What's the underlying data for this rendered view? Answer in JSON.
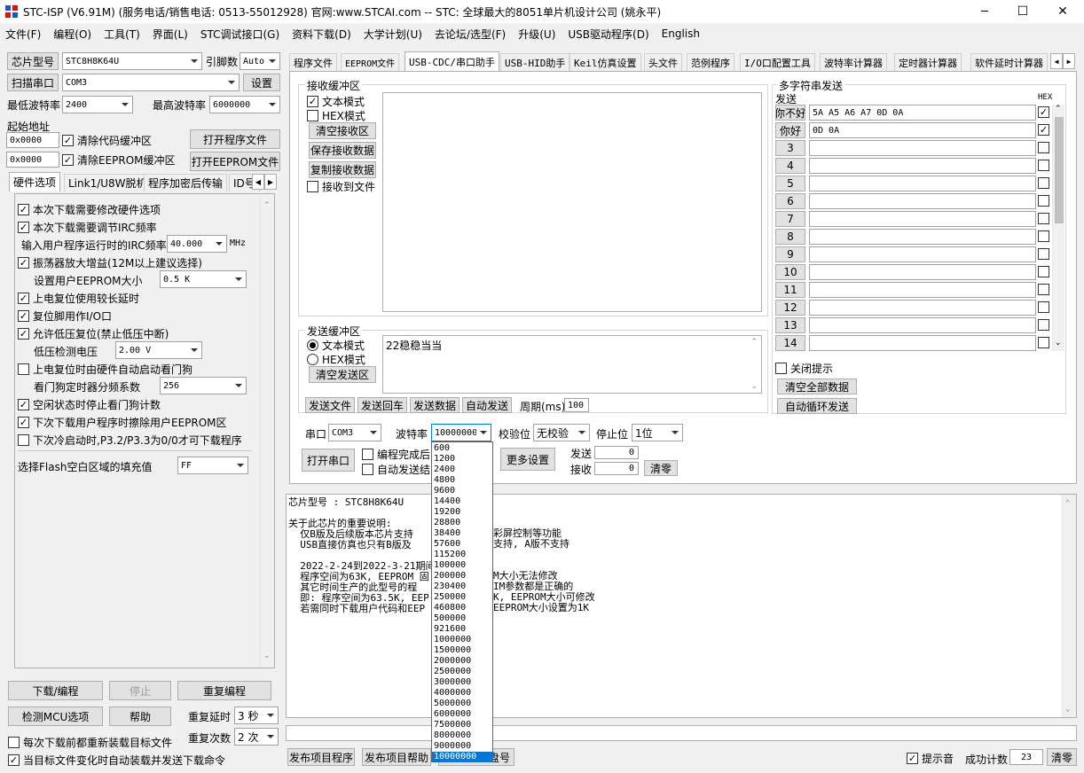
{
  "window": {
    "title": "STC-ISP (V6.91M) (服务电话/销售电话: 0513-55012928) 官网:www.STCAI.com  -- STC: 全球最大的8051单片机设计公司 (姚永平)",
    "controls": [
      "─",
      "☐",
      "✕"
    ]
  },
  "menu": [
    "文件(F)",
    "编程(O)",
    "工具(T)",
    "界面(L)",
    "STC调试接口(G)",
    "资料下载(D)",
    "大学计划(U)",
    "去论坛/选型(F)",
    "升级(U)",
    "USB驱动程序(D)",
    "English"
  ],
  "left": {
    "chip_btn": "芯片型号",
    "chip_value": "STC8H8K64U",
    "pins_label": "引脚数",
    "pins_value": "Auto",
    "scan_btn": "扫描串口",
    "port_value": "COM3",
    "settings_btn": "设置",
    "min_baud_label": "最低波特率",
    "min_baud_value": "2400",
    "max_baud_label": "最高波特率",
    "max_baud_value": "6000000",
    "start_addr_label": "起始地址",
    "addr1": "0x0000",
    "clear_code": "清除代码缓冲区",
    "open_prog": "打开程序文件",
    "addr2": "0x0000",
    "clear_eeprom": "清除EEPROM缓冲区",
    "open_eeprom": "打开EEPROM文件",
    "tabs": [
      "硬件选项",
      "Link1/U8W脱机",
      "程序加密后传输",
      "ID号"
    ],
    "hw": {
      "opt1": "本次下载需要修改硬件选项",
      "opt2": "本次下载需要调节IRC频率",
      "irc_label": "输入用户程序运行时的IRC频率",
      "irc_value": "40.000",
      "irc_unit": "MHz",
      "opt3": "振荡器放大增益(12M以上建议选择)",
      "eeprom_label": "设置用户EEPROM大小",
      "eeprom_value": "0.5 K",
      "opt4": "上电复位使用较长延时",
      "opt5": "复位脚用作I/O口",
      "opt6": "允许低压复位(禁止低压中断)",
      "lv_label": "低压检测电压",
      "lv_value": "2.00 V",
      "opt7": "上电复位时由硬件自动启动看门狗",
      "wdt_label": "看门狗定时器分频系数",
      "wdt_value": "256",
      "opt8": "空闲状态时停止看门狗计数",
      "opt9": "下次下载用户程序时擦除用户EEPROM区",
      "opt10": "下次冷启动时,P3.2/P3.3为0/0才可下载程序",
      "fill_label": "选择Flash空白区域的填充值",
      "fill_value": "FF"
    },
    "download_btn": "下载/编程",
    "stop_btn": "停止",
    "reprog_btn": "重复编程",
    "detect_btn": "检测MCU选项",
    "help_btn": "帮助",
    "delay_label": "重复延时",
    "delay_value": "3 秒",
    "times_label": "重复次数",
    "times_value": "2 次",
    "reload_each": "每次下载前都重新装载目标文件",
    "auto_reload": "当目标文件变化时自动装载并发送下载命令"
  },
  "tabs": [
    "程序文件",
    "EEPROM文件",
    "USB-CDC/串口助手",
    "USB-HID助手",
    "Keil仿真设置",
    "头文件",
    "范例程序",
    "I/O口配置工具",
    "波特率计算器",
    "定时器计算器",
    "软件延时计算器"
  ],
  "recv": {
    "title": "接收缓冲区",
    "text_mode": "文本模式",
    "hex_mode": "HEX模式",
    "clear": "清空接收区",
    "save": "保存接收数据",
    "copy": "复制接收数据",
    "to_file": "接收到文件"
  },
  "send": {
    "title": "发送缓冲区",
    "text_mode": "文本模式",
    "hex_mode": "HEX模式",
    "clear": "清空发送区",
    "content": "22稳稳当当",
    "send_file": "发送文件",
    "send_cr": "发送回车",
    "send_data": "发送数据",
    "auto_send": "自动发送",
    "period_label": "周期(ms)",
    "period_value": "100"
  },
  "multi": {
    "title": "多字符串发送",
    "send_label": "发送",
    "hex_label": "HEX",
    "rows": [
      {
        "btn": "你不好",
        "value": "5A A5 A6 A7 0D 0A",
        "hex": true
      },
      {
        "btn": "你好",
        "value": "0D 0A",
        "hex": true
      },
      {
        "btn": "3",
        "value": "",
        "hex": false
      },
      {
        "btn": "4",
        "value": "",
        "hex": false
      },
      {
        "btn": "5",
        "value": "",
        "hex": false
      },
      {
        "btn": "6",
        "value": "",
        "hex": false
      },
      {
        "btn": "7",
        "value": "",
        "hex": false
      },
      {
        "btn": "8",
        "value": "",
        "hex": false
      },
      {
        "btn": "9",
        "value": "",
        "hex": false
      },
      {
        "btn": "10",
        "value": "",
        "hex": false
      },
      {
        "btn": "11",
        "value": "",
        "hex": false
      },
      {
        "btn": "12",
        "value": "",
        "hex": false
      },
      {
        "btn": "13",
        "value": "",
        "hex": false
      },
      {
        "btn": "14",
        "value": "",
        "hex": false
      }
    ],
    "close_tip": "关闭提示",
    "clear_all": "清空全部数据",
    "auto_loop": "自动循环发送"
  },
  "serial": {
    "port_label": "串口",
    "port_value": "COM3",
    "baud_label": "波特率",
    "baud_value": "10000000",
    "parity_label": "校验位",
    "parity_value": "无校验",
    "stop_label": "停止位",
    "stop_value": "1位",
    "open_btn": "打开串口",
    "opt1": "编程完成后自",
    "opt2": "自动发送结",
    "more_btn": "更多设置",
    "sent_label": "发送",
    "sent_value": "0",
    "recv_label": "接收",
    "recv_value": "0",
    "clear_btn": "清零"
  },
  "baud_options": [
    "600",
    "1200",
    "2400",
    "4800",
    "9600",
    "14400",
    "19200",
    "28800",
    "38400",
    "57600",
    "115200",
    "100000",
    "200000",
    "230400",
    "250000",
    "460800",
    "500000",
    "921600",
    "1000000",
    "1500000",
    "2000000",
    "2500000",
    "3000000",
    "4000000",
    "5000000",
    "6000000",
    "7500000",
    "8000000",
    "9000000",
    "10000000"
  ],
  "log": [
    "芯片型号 : STC8H8K64U",
    "",
    "关于此芯片的重要说明:",
    "  仅B版及后续版本芯片支持",
    "  USB直接仿真也只有B版及",
    "",
    "  2022-2-24到2022-3-21期间生",
    "  程序空间为63K, EEPROM 固",
    "  其它时间生产的此型号的程",
    "  即: 程序空间为63.5K, EEP",
    "  若需同时下载用户代码和EEP"
  ],
  "log_right": [
    "",
    "",
    "",
    "彩屏控制等功能",
    "支持, A版不支持",
    "",
    "",
    "M大小无法修改",
    "IM参数都是正确的",
    "K, EEPROM大小可修改",
    "EEPROM大小设置为1K"
  ],
  "bottom": {
    "publish": "发布项目程序",
    "publish_help": "发布项目帮助",
    "read_disk": "盘号",
    "sound": "提示音",
    "success_label": "成功计数",
    "success_value": "23",
    "clear": "清零"
  },
  "colors": {
    "bg": "#f0f0f0",
    "highlight": "#0078d7"
  }
}
